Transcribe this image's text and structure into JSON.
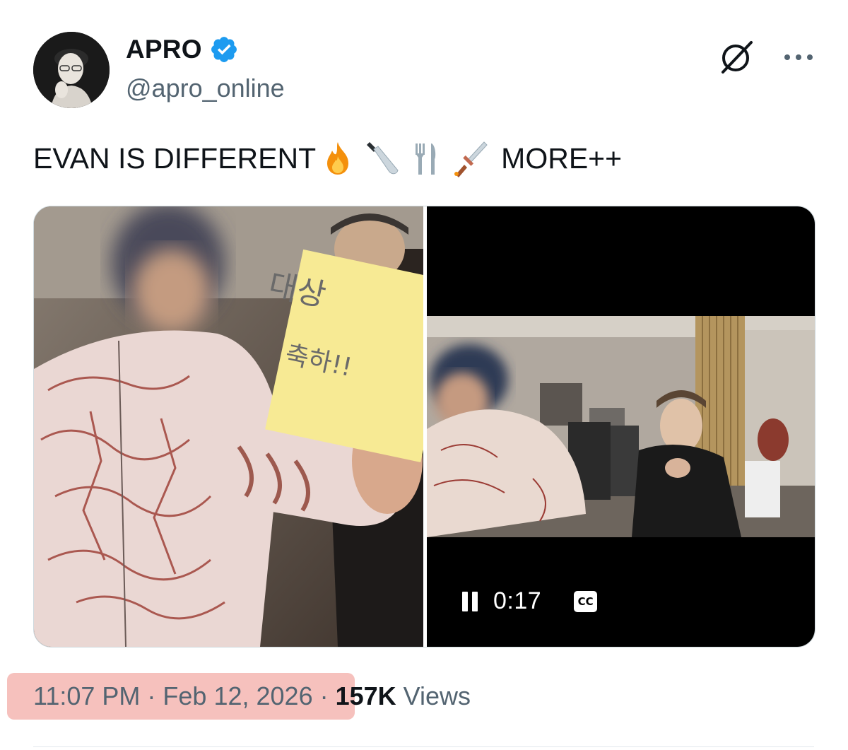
{
  "author": {
    "display_name": "APRO",
    "handle": "@apro_online",
    "verified": true,
    "avatar_icon": "profile-photo"
  },
  "tweet": {
    "text_before": "EVAN IS DIFFERENT",
    "emojis": [
      "fire",
      "kitchen-knife",
      "fork-and-knife",
      "dagger"
    ],
    "text_after": "MORE++"
  },
  "media": {
    "photo_note_text": [
      "대상",
      "축하!!"
    ],
    "video": {
      "time": "0:17",
      "cc_label": "CC",
      "state": "playing"
    }
  },
  "meta": {
    "time": "11:07 PM",
    "separator": "·",
    "date": "Feb 12, 2026",
    "views_count": "157K",
    "views_label": "Views"
  },
  "colors": {
    "verified_blue": "#1d9bf0",
    "secondary_text": "#536471",
    "highlight": "#f4b6b1"
  }
}
